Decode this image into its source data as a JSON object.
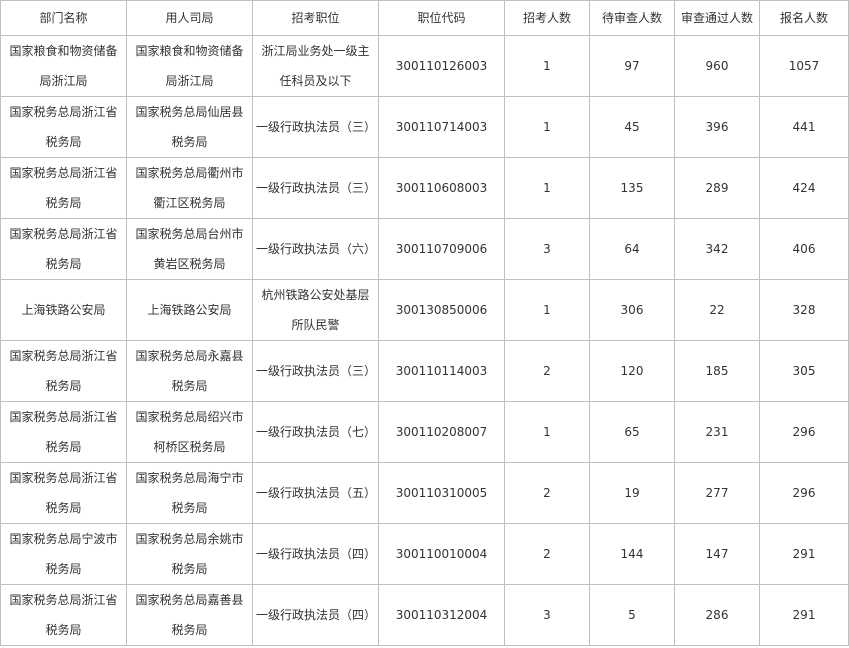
{
  "headers": [
    "部门名称",
    "用人司局",
    "招考职位",
    "职位代码",
    "招考人数",
    "待审查人数",
    "审查通过人数",
    "报名人数"
  ],
  "rows": [
    {
      "dept": "国家粮食和物资储备局浙江局",
      "bureau": "国家粮食和物资储备局浙江局",
      "position": "浙江局业务处一级主任科员及以下",
      "code": "300110126003",
      "recruit": "1",
      "pending": "97",
      "passed": "960",
      "total": "1057"
    },
    {
      "dept": "国家税务总局浙江省税务局",
      "bureau": "国家税务总局仙居县税务局",
      "position": "一级行政执法员（三）",
      "code": "300110714003",
      "recruit": "1",
      "pending": "45",
      "passed": "396",
      "total": "441"
    },
    {
      "dept": "国家税务总局浙江省税务局",
      "bureau": "国家税务总局衢州市衢江区税务局",
      "position": "一级行政执法员（三）",
      "code": "300110608003",
      "recruit": "1",
      "pending": "135",
      "passed": "289",
      "total": "424"
    },
    {
      "dept": "国家税务总局浙江省税务局",
      "bureau": "国家税务总局台州市黄岩区税务局",
      "position": "一级行政执法员（六）",
      "code": "300110709006",
      "recruit": "3",
      "pending": "64",
      "passed": "342",
      "total": "406"
    },
    {
      "dept": "上海铁路公安局",
      "bureau": "上海铁路公安局",
      "position": "杭州铁路公安处基层所队民警",
      "code": "300130850006",
      "recruit": "1",
      "pending": "306",
      "passed": "22",
      "total": "328"
    },
    {
      "dept": "国家税务总局浙江省税务局",
      "bureau": "国家税务总局永嘉县税务局",
      "position": "一级行政执法员（三）",
      "code": "300110114003",
      "recruit": "2",
      "pending": "120",
      "passed": "185",
      "total": "305"
    },
    {
      "dept": "国家税务总局浙江省税务局",
      "bureau": "国家税务总局绍兴市柯桥区税务局",
      "position": "一级行政执法员（七）",
      "code": "300110208007",
      "recruit": "1",
      "pending": "65",
      "passed": "231",
      "total": "296"
    },
    {
      "dept": "国家税务总局浙江省税务局",
      "bureau": "国家税务总局海宁市税务局",
      "position": "一级行政执法员（五）",
      "code": "300110310005",
      "recruit": "2",
      "pending": "19",
      "passed": "277",
      "total": "296"
    },
    {
      "dept": "国家税务总局宁波市税务局",
      "bureau": "国家税务总局余姚市税务局",
      "position": "一级行政执法员（四）",
      "code": "300110010004",
      "recruit": "2",
      "pending": "144",
      "passed": "147",
      "total": "291"
    },
    {
      "dept": "国家税务总局浙江省税务局",
      "bureau": "国家税务总局嘉善县税务局",
      "position": "一级行政执法员（四）",
      "code": "300110312004",
      "recruit": "3",
      "pending": "5",
      "passed": "286",
      "total": "291"
    }
  ]
}
